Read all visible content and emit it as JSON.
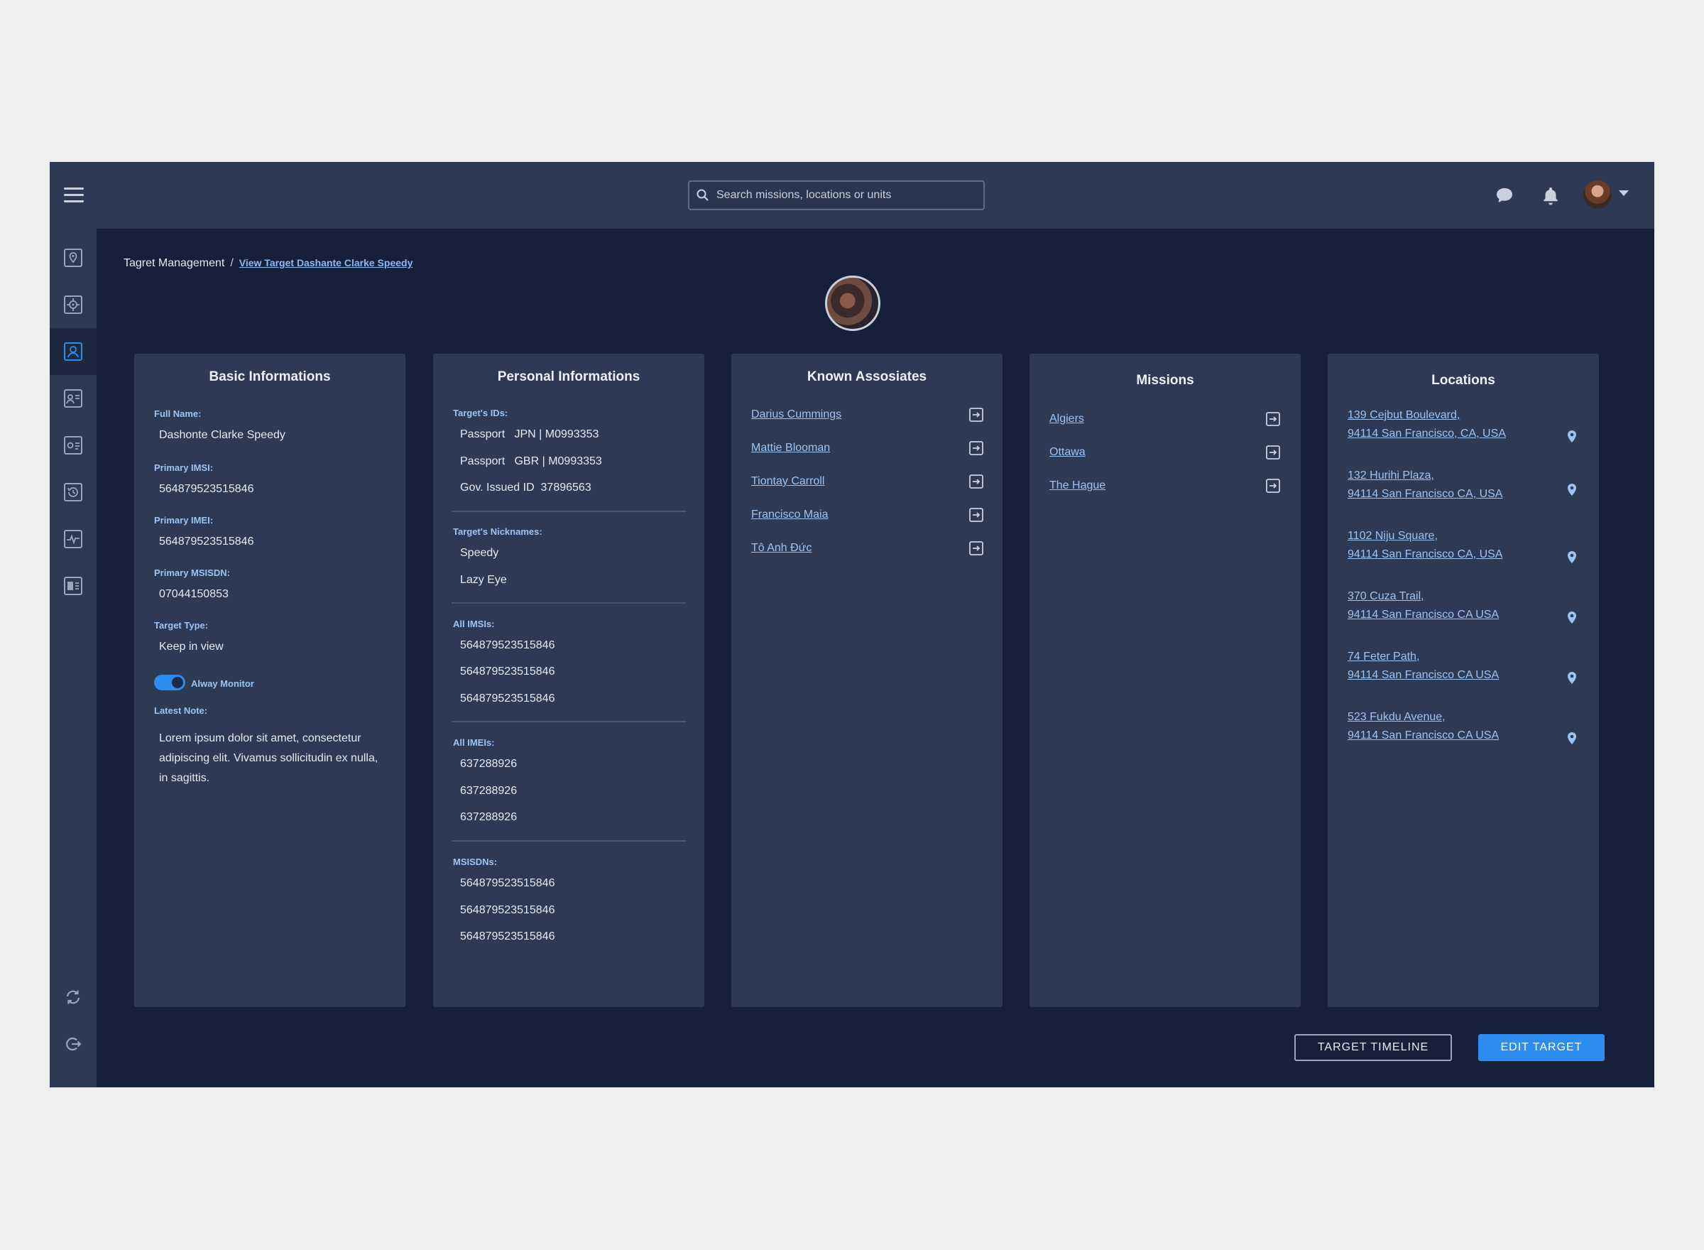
{
  "header": {
    "search": {
      "placeholder": "Search missions, locations or units",
      "icon": "search-icon"
    },
    "icons": [
      "menu-icon",
      "chat-icon",
      "bell-icon",
      "avatar",
      "caret-down-icon"
    ]
  },
  "sidebar": {
    "items": [
      {
        "icon": "map-pin-icon",
        "active": false
      },
      {
        "icon": "target-scope-icon",
        "active": false
      },
      {
        "icon": "person-target-icon",
        "active": true
      },
      {
        "icon": "contact-card-icon",
        "active": false
      },
      {
        "icon": "id-card-icon",
        "active": false
      },
      {
        "icon": "history-icon",
        "active": false
      },
      {
        "icon": "activity-icon",
        "active": false
      },
      {
        "icon": "dashboard-icon",
        "active": false
      }
    ],
    "bottom": [
      "sync-icon",
      "logout-icon"
    ]
  },
  "breadcrumb": {
    "root": "Tagret Management",
    "separator": "/",
    "current": "View Target Dashante Clarke Speedy"
  },
  "basic": {
    "title": "Basic Informations",
    "full_name_label": "Full Name:",
    "full_name": "Dashonte Clarke Speedy",
    "imsi_label": "Primary IMSI:",
    "imsi": "564879523515846",
    "imei_label": "Primary IMEI:",
    "imei": "564879523515846",
    "msisdn_label": "Primary MSISDN:",
    "msisdn": "07044150853",
    "type_label": "Target Type:",
    "type": "Keep in view",
    "monitor_label": "Alway Monitor",
    "monitor_on": true,
    "note_label": "Latest Note:",
    "note": "Lorem ipsum dolor sit amet, consectetur adipiscing elit. Vivamus sollicitudin ex nulla, in sagittis."
  },
  "personal": {
    "title": "Personal Informations",
    "ids_label": "Target's IDs:",
    "ids": [
      {
        "type": "Passport",
        "value": "JPN | M0993353"
      },
      {
        "type": "Passport",
        "value": "GBR | M0993353"
      },
      {
        "type": "Gov. Issued ID",
        "value": "37896563"
      }
    ],
    "nicknames_label": "Target's Nicknames:",
    "nicknames": [
      "Speedy",
      "Lazy Eye"
    ],
    "imsis_label": "All IMSIs:",
    "imsis": [
      "564879523515846",
      "564879523515846",
      "564879523515846"
    ],
    "imeis_label": "All IMEIs:",
    "imeis": [
      "637288926",
      "637288926",
      "637288926"
    ],
    "msisdns_label": "MSISDNs:",
    "msisdns": [
      "564879523515846",
      "564879523515846",
      "564879523515846"
    ]
  },
  "associates": {
    "title": "Known Assosiates",
    "items": [
      "Darius Cummings",
      "Mattie Blooman",
      "Tiontay Carroll",
      "Francisco Maia",
      "Tô Anh Đức"
    ]
  },
  "missions": {
    "title": "Missions",
    "items": [
      "Algiers",
      "Ottawa",
      "The Hague"
    ]
  },
  "locations": {
    "title": "Locations",
    "items": [
      {
        "line1": "139 Cejbut Boulevard,",
        "line2": "94114 San Francisco, CA, USA"
      },
      {
        "line1": "132 Hurihi Plaza,",
        "line2": "94114 San Francisco CA, USA"
      },
      {
        "line1": "1102 Niju Square,",
        "line2": "94114 San Francisco CA, USA"
      },
      {
        "line1": "370 Cuza Trail,",
        "line2": "94114 San Francisco CA USA"
      },
      {
        "line1": "74 Feter Path,",
        "line2": "94114 San Francisco CA USA"
      },
      {
        "line1": "523 Fukdu Avenue,",
        "line2": "94114 San Francisco CA USA"
      }
    ]
  },
  "actions": {
    "timeline": "TARGET TIMELINE",
    "edit": "EDIT TARGET"
  },
  "colors": {
    "accent": "#2d8cf0",
    "panel": "#2e3a54",
    "background": "#17203a",
    "link": "#9dc3f4"
  }
}
